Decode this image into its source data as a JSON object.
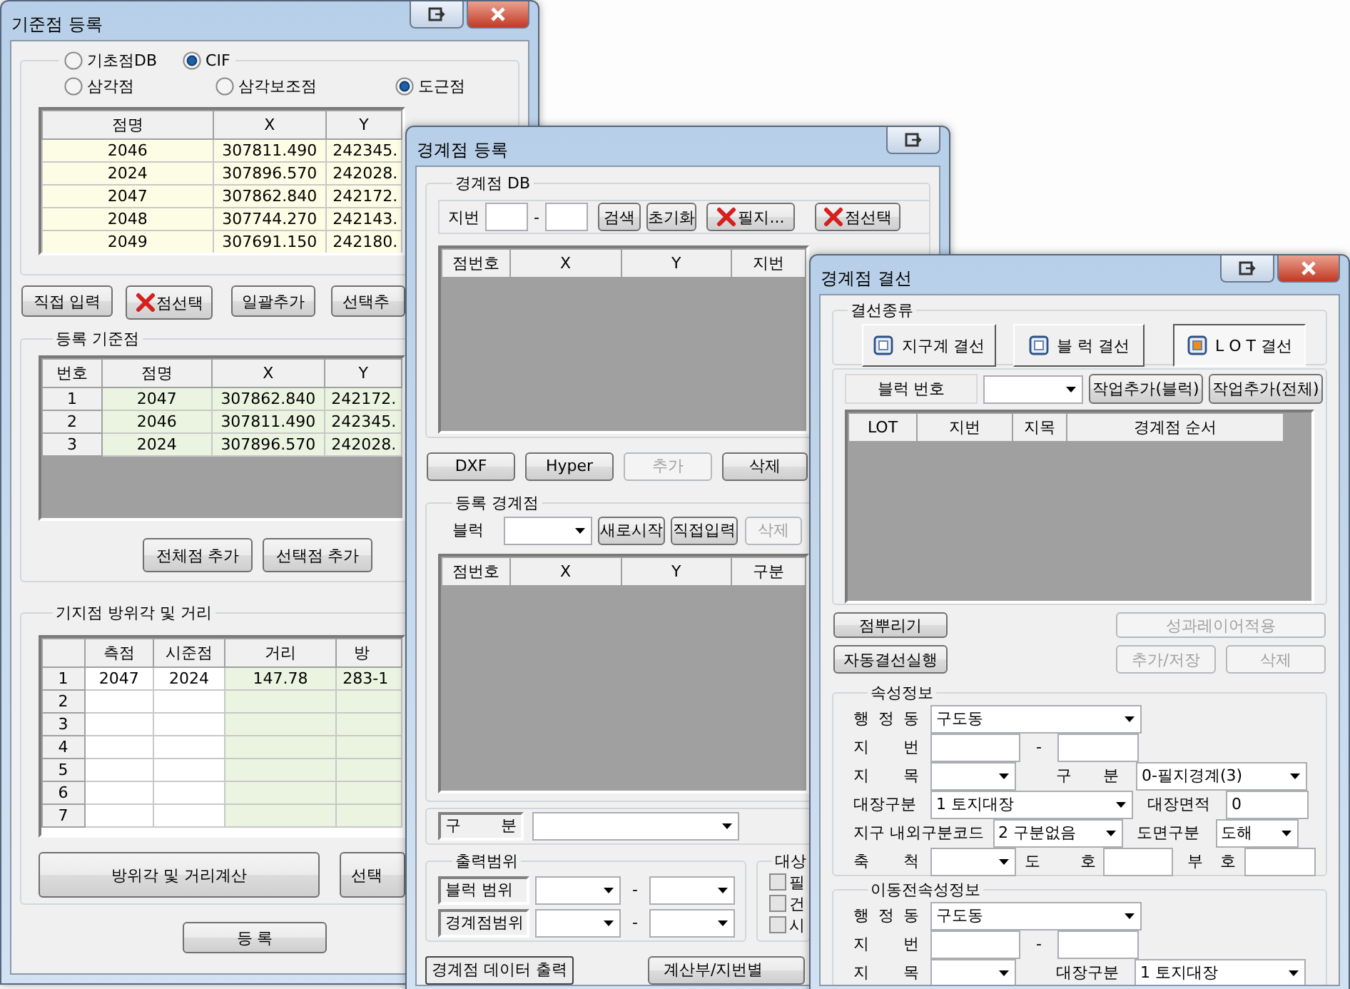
{
  "base_point_window": {
    "title": "기준점 등록",
    "source_options": [
      {
        "label": "기초점DB",
        "selected": false
      },
      {
        "label": "CIF",
        "selected": true
      }
    ],
    "point_types": [
      {
        "label": "삼각점",
        "selected": false
      },
      {
        "label": "삼각보조점",
        "selected": false
      },
      {
        "label": "도근점",
        "selected": true
      }
    ],
    "point_table": {
      "columns": [
        "점명",
        "X",
        "Y"
      ],
      "rows": [
        [
          "2046",
          "307811.490",
          "242345."
        ],
        [
          "2024",
          "307896.570",
          "242028."
        ],
        [
          "2047",
          "307862.840",
          "242172."
        ],
        [
          "2048",
          "307744.270",
          "242143."
        ],
        [
          "2049",
          "307691.150",
          "242180."
        ]
      ]
    },
    "point_buttons": [
      {
        "label": "직접 입력",
        "kind": "text"
      },
      {
        "label": "점선택",
        "kind": "cross"
      },
      {
        "label": "일괄추가",
        "kind": "text"
      },
      {
        "label": "선택추",
        "kind": "text"
      }
    ],
    "registered": {
      "title": "등록 기준점",
      "columns": [
        "번호",
        "점명",
        "X",
        "Y"
      ],
      "rows": [
        [
          "1",
          "2047",
          "307862.840",
          "242172."
        ],
        [
          "2",
          "2046",
          "307811.490",
          "242345."
        ],
        [
          "3",
          "2024",
          "307896.570",
          "242028."
        ]
      ],
      "buttons": [
        "전체점 추가",
        "선택점 추가"
      ]
    },
    "bearing": {
      "title": "기지점 방위각 및 거리",
      "columns": [
        "측점",
        "시준점",
        "거리",
        "방"
      ],
      "rows": [
        {
          "number": "1",
          "cells": [
            "2047",
            "2024",
            "147.78",
            "283-1"
          ]
        },
        {
          "number": "2"
        },
        {
          "number": "3"
        },
        {
          "number": "4"
        },
        {
          "number": "5"
        },
        {
          "number": "6"
        },
        {
          "number": "7"
        }
      ],
      "buttons": [
        "방위각 및 거리계산",
        "선택"
      ]
    },
    "footer_buttons": [
      "등 록"
    ]
  },
  "boundary_window": {
    "title": "경계점 등록",
    "db": {
      "title": "경계점 DB",
      "parcel_label": "지번",
      "separator": "-",
      "buttons": [
        {
          "label": "검색",
          "kind": "text"
        },
        {
          "label": "초기화",
          "kind": "text"
        },
        {
          "label": "필지...",
          "kind": "cross"
        },
        {
          "label": "점선택",
          "kind": "cross"
        }
      ],
      "columns": [
        "점번호",
        "X",
        "Y",
        "지번"
      ]
    },
    "tool_buttons": [
      {
        "label": "DXF",
        "disabled": false
      },
      {
        "label": "Hyper",
        "disabled": false
      },
      {
        "label": "추가",
        "disabled": true
      },
      {
        "label": "삭제",
        "disabled": false
      }
    ],
    "registered": {
      "title": "등록 경계점",
      "block_label": "블럭",
      "buttons": [
        {
          "label": "새로시작",
          "disabled": false
        },
        {
          "label": "직접입력",
          "disabled": false
        },
        {
          "label": "삭제",
          "disabled": true
        }
      ],
      "columns": [
        "점번호",
        "X",
        "Y",
        "구분"
      ]
    },
    "category": {
      "label": "구 분"
    },
    "output_range": {
      "title": "출력범위",
      "rows": [
        {
          "label": "블럭 범위",
          "separator": "-"
        },
        {
          "label": "경계점범위",
          "separator": "-"
        }
      ]
    },
    "targets": {
      "title": "대상",
      "items": [
        {
          "label": "필",
          "checked": false
        },
        {
          "label": "건",
          "checked": false
        },
        {
          "label": "시",
          "checked": false
        }
      ]
    },
    "bottom_buttons": [
      "경계점 데이터 출력",
      "계산부/지번별"
    ]
  },
  "connection_window": {
    "title": "경계점 결선",
    "types": {
      "title": "결선종류",
      "items": [
        {
          "label": "지구계 결선",
          "selected": false
        },
        {
          "label": "블 럭 결선",
          "selected": false
        },
        {
          "label": "L O T 결선",
          "selected": true
        }
      ]
    },
    "block_label": "블럭 번호",
    "work_buttons": [
      "작업추가(블럭)",
      "작업추가(전체)"
    ],
    "columns": [
      "LOT",
      "지번",
      "지목",
      "경계점 순서"
    ],
    "actions": [
      {
        "label": "점뿌리기",
        "disabled": false
      },
      {
        "label": "성과레이어적용",
        "disabled": true
      },
      {
        "label": "자동결선실행",
        "disabled": false
      },
      {
        "label": "추가/저장",
        "disabled": true
      },
      {
        "label": "삭제",
        "disabled": true
      }
    ],
    "attributes": {
      "title": "속성정보",
      "district": {
        "label": "행 정 동",
        "value": "구도동"
      },
      "parcel": {
        "label": "지 번",
        "separator": "-"
      },
      "land_category": {
        "label": "지 목"
      },
      "division": {
        "label": "구 분",
        "value": "0-필지경계(3)"
      },
      "register_type": {
        "label": "대장구분",
        "value": "1 토지대장"
      },
      "register_area": {
        "label": "대장면적",
        "value": "0"
      },
      "zone_code": {
        "label": "지구 내외구분코드",
        "value": "2 구분없음"
      },
      "map_type": {
        "label": "도면구분",
        "value": "도해"
      },
      "scale": {
        "label": "축 척"
      },
      "sheet_no": {
        "label": "도 호"
      },
      "sub_no": {
        "label": "부 호"
      }
    },
    "previous_attributes": {
      "title": "이동전속성정보",
      "district": {
        "label": "행 정 동",
        "value": "구도동"
      },
      "parcel": {
        "label": "지 번",
        "separator": "-"
      },
      "land_category": {
        "label": "지 목"
      },
      "register_type": {
        "label": "대장구분",
        "value": "1 토지대장"
      }
    }
  }
}
